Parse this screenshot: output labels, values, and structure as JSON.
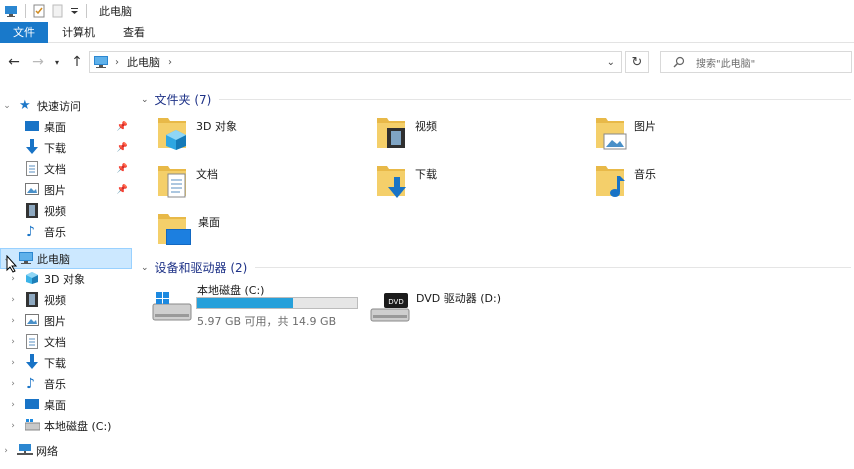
{
  "window": {
    "title": "此电脑"
  },
  "ribbon": {
    "tabs": [
      "文件",
      "计算机",
      "查看"
    ]
  },
  "address": {
    "crumb": "此电脑",
    "search_placeholder": "搜索\"此电脑\""
  },
  "nav": {
    "quick_access": "快速访问",
    "quick_items": [
      "桌面",
      "下载",
      "文档",
      "图片",
      "视频",
      "音乐"
    ],
    "this_pc": "此电脑",
    "pc_items": [
      "3D 对象",
      "视频",
      "图片",
      "文档",
      "下载",
      "音乐",
      "桌面",
      "本地磁盘 (C:)"
    ],
    "network": "网络"
  },
  "folders": {
    "header": "文件夹 (7)",
    "items": [
      "3D 对象",
      "视频",
      "图片",
      "文档",
      "下载",
      "音乐",
      "桌面"
    ]
  },
  "devices": {
    "header": "设备和驱动器 (2)",
    "drive_c": {
      "name": "本地磁盘 (C:)",
      "usage": "5.97 GB 可用，共 14.9 GB",
      "used_fraction": 0.6
    },
    "drive_d": {
      "name": "DVD 驱动器 (D:)",
      "badge": "DVD"
    }
  },
  "colors": {
    "accent": "#1979ca",
    "selection": "#cce8ff",
    "section_text": "#1e3287",
    "folder": "#e8b948",
    "drive_bar": "#26a0da"
  }
}
